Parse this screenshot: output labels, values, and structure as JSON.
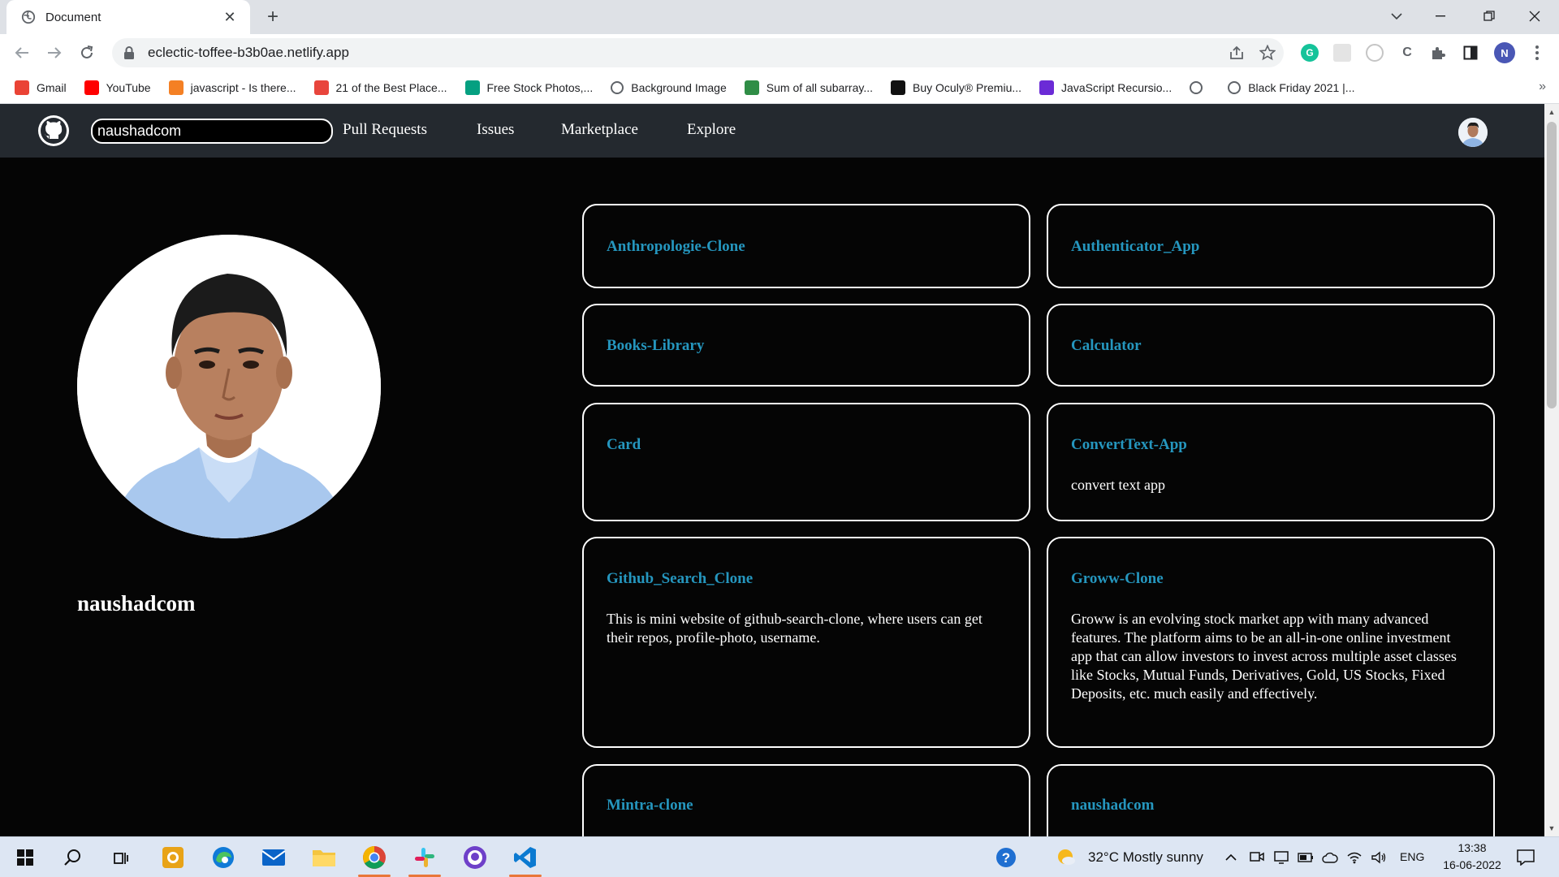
{
  "browser": {
    "tab_title": "Document",
    "url": "eclectic-toffee-b3b0ae.netlify.app",
    "profile_initial": "N",
    "bookmarks": [
      {
        "label": "Gmail",
        "icon": "gmail-icon",
        "color": "#ea4335"
      },
      {
        "label": "YouTube",
        "icon": "youtube-icon",
        "color": "#ff0000"
      },
      {
        "label": "javascript - Is there...",
        "icon": "stackoverflow-icon",
        "color": "#f48024"
      },
      {
        "label": "21 of the Best Place...",
        "icon": "pin-icon",
        "color": "#e8453c"
      },
      {
        "label": "Free Stock Photos,...",
        "icon": "pexels-icon",
        "color": "#05a081"
      },
      {
        "label": "Background Image",
        "icon": "globe-icon",
        "color": "#5f6368"
      },
      {
        "label": "Sum of all subarray...",
        "icon": "gfg-icon",
        "color": "#2f8d46"
      },
      {
        "label": "Buy Oculy® Premiu...",
        "icon": "amazon-icon",
        "color": "#111111"
      },
      {
        "label": "JavaScript Recursio...",
        "icon": "programiz-icon",
        "color": "#6b2bd6"
      },
      {
        "label": "",
        "icon": "globe-icon",
        "color": "#5f6368"
      },
      {
        "label": "Black Friday 2021 |...",
        "icon": "globe-icon",
        "color": "#5f6368"
      }
    ]
  },
  "site": {
    "search_value": "naushadcom",
    "nav_links": [
      "Pull Requests",
      "Issues",
      "Marketplace",
      "Explore"
    ],
    "username": "naushadcom"
  },
  "repos": [
    {
      "name": "Anthropologie-Clone",
      "desc": ""
    },
    {
      "name": "Authenticator_App",
      "desc": ""
    },
    {
      "name": "Books-Library",
      "desc": ""
    },
    {
      "name": "Calculator",
      "desc": ""
    },
    {
      "name": "Card",
      "desc": ""
    },
    {
      "name": "ConvertText-App",
      "desc": "convert text app"
    },
    {
      "name": "Github_Search_Clone",
      "desc": "This is mini website of github-search-clone, where users can get their repos, profile-photo, username."
    },
    {
      "name": "Groww-Clone",
      "desc": "Groww is an evolving stock market app with many advanced features. The platform aims to be an all-in-one online investment app that can allow investors to invest across multiple asset classes like Stocks, Mutual Funds, Derivatives, Gold, US Stocks, Fixed Deposits, etc. much easily and effectively."
    },
    {
      "name": "Mintra-clone",
      "desc": ""
    },
    {
      "name": "naushadcom",
      "desc": ""
    }
  ],
  "taskbar": {
    "weather": "32°C  Mostly sunny",
    "language": "ENG",
    "time": "13:38",
    "date": "16-06-2022"
  },
  "colors": {
    "accent_repo": "#2596be",
    "nav_bg": "#24292f",
    "page_bg": "#050505"
  }
}
